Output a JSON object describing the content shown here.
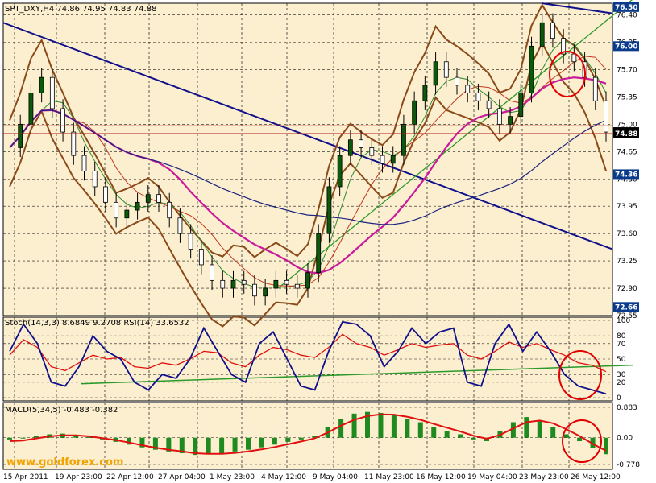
{
  "chart_data": [
    {
      "type": "line",
      "subtype": "candlestick-with-overlays",
      "title": "SPT_DXY,H4  74.86 74.95 74.83 74.88",
      "ylim": [
        72.55,
        76.55
      ],
      "grid": true,
      "y_ticks": [
        "76.40",
        "76.05",
        "75.70",
        "75.35",
        "75.00",
        "74.65",
        "74.30",
        "73.95",
        "73.60",
        "73.25",
        "72.90",
        "72.55"
      ],
      "price_tags": [
        {
          "label": "76.50",
          "value": 76.5,
          "color": "#0a3a8c"
        },
        {
          "label": "76.00",
          "value": 76.0,
          "color": "#0a3a8c"
        },
        {
          "label": "74.88",
          "value": 74.9,
          "color": "#000000"
        },
        {
          "label": "74.88",
          "value": 74.88,
          "color": "#000000"
        },
        {
          "label": "74.36",
          "value": 74.36,
          "color": "#0a3a8c"
        },
        {
          "label": "72.66",
          "value": 72.66,
          "color": "#0a3a8c"
        }
      ],
      "x_labels": [
        "15 Apr 2011",
        "19 Apr 23:00",
        "22 Apr 12:00",
        "27 Apr 04:00",
        "1 May 23:00",
        "4 May 12:00",
        "9 May 04:00",
        "11 May 23:00",
        "16 May 12:00",
        "19 May 04:00",
        "23 May 23:00",
        "26 May 12:00"
      ],
      "close_series": [
        74.7,
        75.0,
        75.4,
        75.6,
        75.2,
        74.9,
        74.6,
        74.4,
        74.2,
        74.0,
        73.8,
        73.9,
        74.0,
        74.1,
        74.0,
        73.8,
        73.6,
        73.4,
        73.2,
        73.0,
        72.9,
        73.0,
        72.95,
        72.8,
        72.9,
        73.0,
        72.95,
        72.9,
        73.1,
        73.6,
        74.2,
        74.6,
        74.8,
        74.7,
        74.6,
        74.5,
        74.6,
        75.0,
        75.3,
        75.5,
        75.8,
        75.6,
        75.5,
        75.4,
        75.3,
        75.2,
        75.0,
        75.1,
        75.4,
        76.0,
        76.3,
        76.1,
        75.9,
        75.8,
        75.6,
        75.3,
        74.9
      ],
      "colors": {
        "background": "#fcefcf",
        "grid": "#1a1a1a",
        "candles_up": "#0a5a0a",
        "bands": "#8a4a1a",
        "ma_magenta": "#c81a9a",
        "ma_blue": "#1a237e",
        "trend_blue": "#10108a",
        "trend_green": "#2a9a2a"
      }
    },
    {
      "type": "line",
      "title": "Stoch(14,3,3) 8.6849 9.2708  RSI(14) 33.6532",
      "ylim": [
        0,
        100
      ],
      "y_ticks": [
        "100",
        "80",
        "70",
        "50",
        "30",
        "20",
        "0"
      ],
      "series": [
        {
          "name": "Stoch(14,3,3)",
          "values": [
            60,
            95,
            70,
            20,
            15,
            40,
            80,
            60,
            50,
            20,
            10,
            30,
            25,
            50,
            90,
            60,
            30,
            20,
            70,
            85,
            50,
            15,
            10,
            60,
            98,
            95,
            80,
            40,
            60,
            90,
            70,
            85,
            90,
            20,
            15,
            70,
            95,
            60,
            85,
            60,
            30,
            15,
            10,
            5
          ]
        },
        {
          "name": "RSI(14)",
          "values": [
            55,
            75,
            65,
            40,
            35,
            45,
            55,
            50,
            52,
            40,
            38,
            45,
            42,
            50,
            60,
            58,
            45,
            40,
            55,
            65,
            62,
            55,
            52,
            65,
            82,
            70,
            65,
            55,
            62,
            70,
            65,
            68,
            70,
            55,
            50,
            60,
            72,
            65,
            70,
            62,
            55,
            45,
            42,
            33.65
          ]
        }
      ]
    },
    {
      "type": "bar",
      "title": "MACD(5,34,5) -0.483 -0.382",
      "ylim": [
        -0.778,
        0.883
      ],
      "y_ticks": [
        "0.883",
        "0.00",
        "-0.778"
      ],
      "values": [
        -0.05,
        -0.02,
        0.05,
        0.1,
        0.12,
        0.08,
        0.02,
        -0.05,
        -0.12,
        -0.2,
        -0.28,
        -0.35,
        -0.4,
        -0.45,
        -0.5,
        -0.48,
        -0.45,
        -0.4,
        -0.35,
        -0.28,
        -0.2,
        -0.12,
        -0.05,
        0.05,
        0.3,
        0.55,
        0.7,
        0.75,
        0.72,
        0.65,
        0.55,
        0.45,
        0.3,
        0.2,
        0.1,
        -0.05,
        -0.1,
        0.2,
        0.45,
        0.6,
        0.5,
        0.3,
        0.1,
        -0.1,
        -0.3,
        -0.48
      ],
      "signal": [
        -0.1,
        -0.08,
        -0.02,
        0.04,
        0.07,
        0.07,
        0.04,
        -0.01,
        -0.07,
        -0.14,
        -0.22,
        -0.29,
        -0.35,
        -0.4,
        -0.45,
        -0.47,
        -0.47,
        -0.44,
        -0.4,
        -0.34,
        -0.27,
        -0.19,
        -0.11,
        -0.02,
        0.15,
        0.35,
        0.52,
        0.63,
        0.68,
        0.67,
        0.61,
        0.52,
        0.4,
        0.29,
        0.18,
        0.06,
        -0.03,
        0.08,
        0.27,
        0.45,
        0.5,
        0.42,
        0.25,
        0.05,
        -0.18,
        -0.38
      ]
    }
  ],
  "watermark": "www.goldforex.com"
}
